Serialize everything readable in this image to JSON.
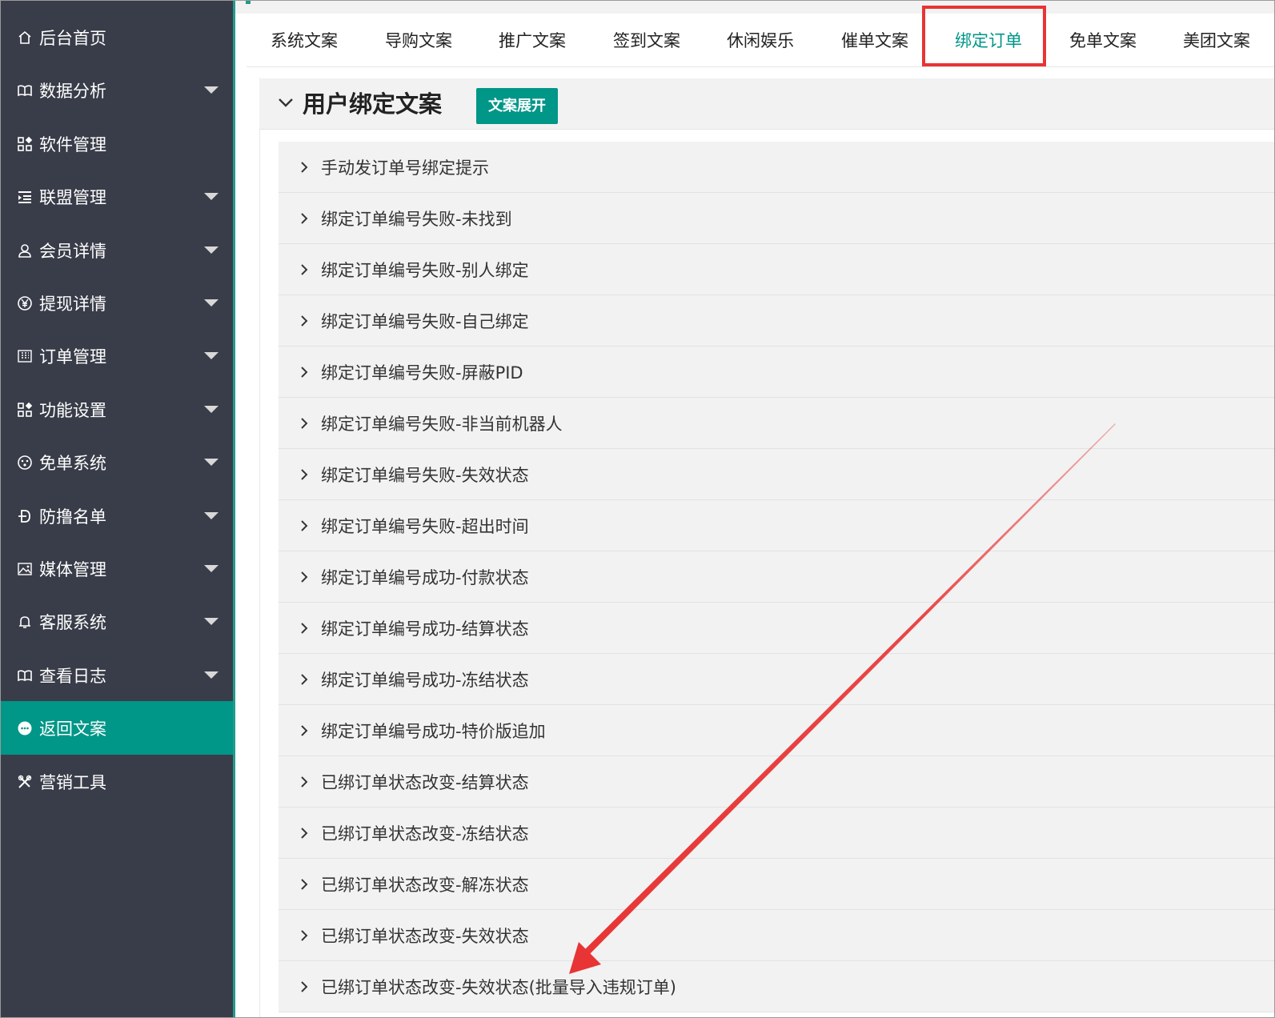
{
  "sidebar": {
    "items": [
      {
        "label": "后台首页",
        "icon": "home-icon",
        "has_caret": false,
        "active": false
      },
      {
        "label": "数据分析",
        "icon": "book-icon",
        "has_caret": true,
        "active": false
      },
      {
        "label": "软件管理",
        "icon": "apps-icon",
        "has_caret": false,
        "active": false
      },
      {
        "label": "联盟管理",
        "icon": "list-indent-icon",
        "has_caret": true,
        "active": false
      },
      {
        "label": "会员详情",
        "icon": "user-icon",
        "has_caret": true,
        "active": false
      },
      {
        "label": "提现详情",
        "icon": "yen-icon",
        "has_caret": true,
        "active": false
      },
      {
        "label": "订单管理",
        "icon": "grid-icon",
        "has_caret": true,
        "active": false
      },
      {
        "label": "功能设置",
        "icon": "apps-icon",
        "has_caret": true,
        "active": false
      },
      {
        "label": "免单系统",
        "icon": "face-icon",
        "has_caret": true,
        "active": false
      },
      {
        "label": "防撸名单",
        "icon": "strike-d-icon",
        "has_caret": true,
        "active": false
      },
      {
        "label": "媒体管理",
        "icon": "image-icon",
        "has_caret": true,
        "active": false
      },
      {
        "label": "客服系统",
        "icon": "bell-icon",
        "has_caret": true,
        "active": false
      },
      {
        "label": "查看日志",
        "icon": "book-icon",
        "has_caret": true,
        "active": false
      },
      {
        "label": "返回文案",
        "icon": "chat-icon",
        "has_caret": false,
        "active": true
      },
      {
        "label": "营销工具",
        "icon": "tools-icon",
        "has_caret": false,
        "active": false
      }
    ]
  },
  "tabs": [
    {
      "label": "系统文案",
      "active": false
    },
    {
      "label": "导购文案",
      "active": false
    },
    {
      "label": "推广文案",
      "active": false
    },
    {
      "label": "签到文案",
      "active": false
    },
    {
      "label": "休闲娱乐",
      "active": false
    },
    {
      "label": "催单文案",
      "active": false
    },
    {
      "label": "绑定订单",
      "active": true
    },
    {
      "label": "免单文案",
      "active": false
    },
    {
      "label": "美团文案",
      "active": false
    }
  ],
  "panel": {
    "title": "用户绑定文案",
    "expand_button": "文案展开"
  },
  "list_items": [
    "手动发订单号绑定提示",
    "绑定订单编号失败-未找到",
    "绑定订单编号失败-别人绑定",
    "绑定订单编号失败-自己绑定",
    "绑定订单编号失败-屏蔽PID",
    "绑定订单编号失败-非当前机器人",
    "绑定订单编号失败-失效状态",
    "绑定订单编号失败-超出时间",
    "绑定订单编号成功-付款状态",
    "绑定订单编号成功-结算状态",
    "绑定订单编号成功-冻结状态",
    "绑定订单编号成功-特价版追加",
    "已绑订单状态改变-结算状态",
    "已绑订单状态改变-冻结状态",
    "已绑订单状态改变-解冻状态",
    "已绑订单状态改变-失效状态",
    "已绑订单状态改变-失效状态(批量导入违规订单)"
  ],
  "colors": {
    "sidebar_bg": "#393d49",
    "accent": "#009688",
    "highlight_box": "#e83434",
    "annotation_arrow": "#e83434"
  }
}
